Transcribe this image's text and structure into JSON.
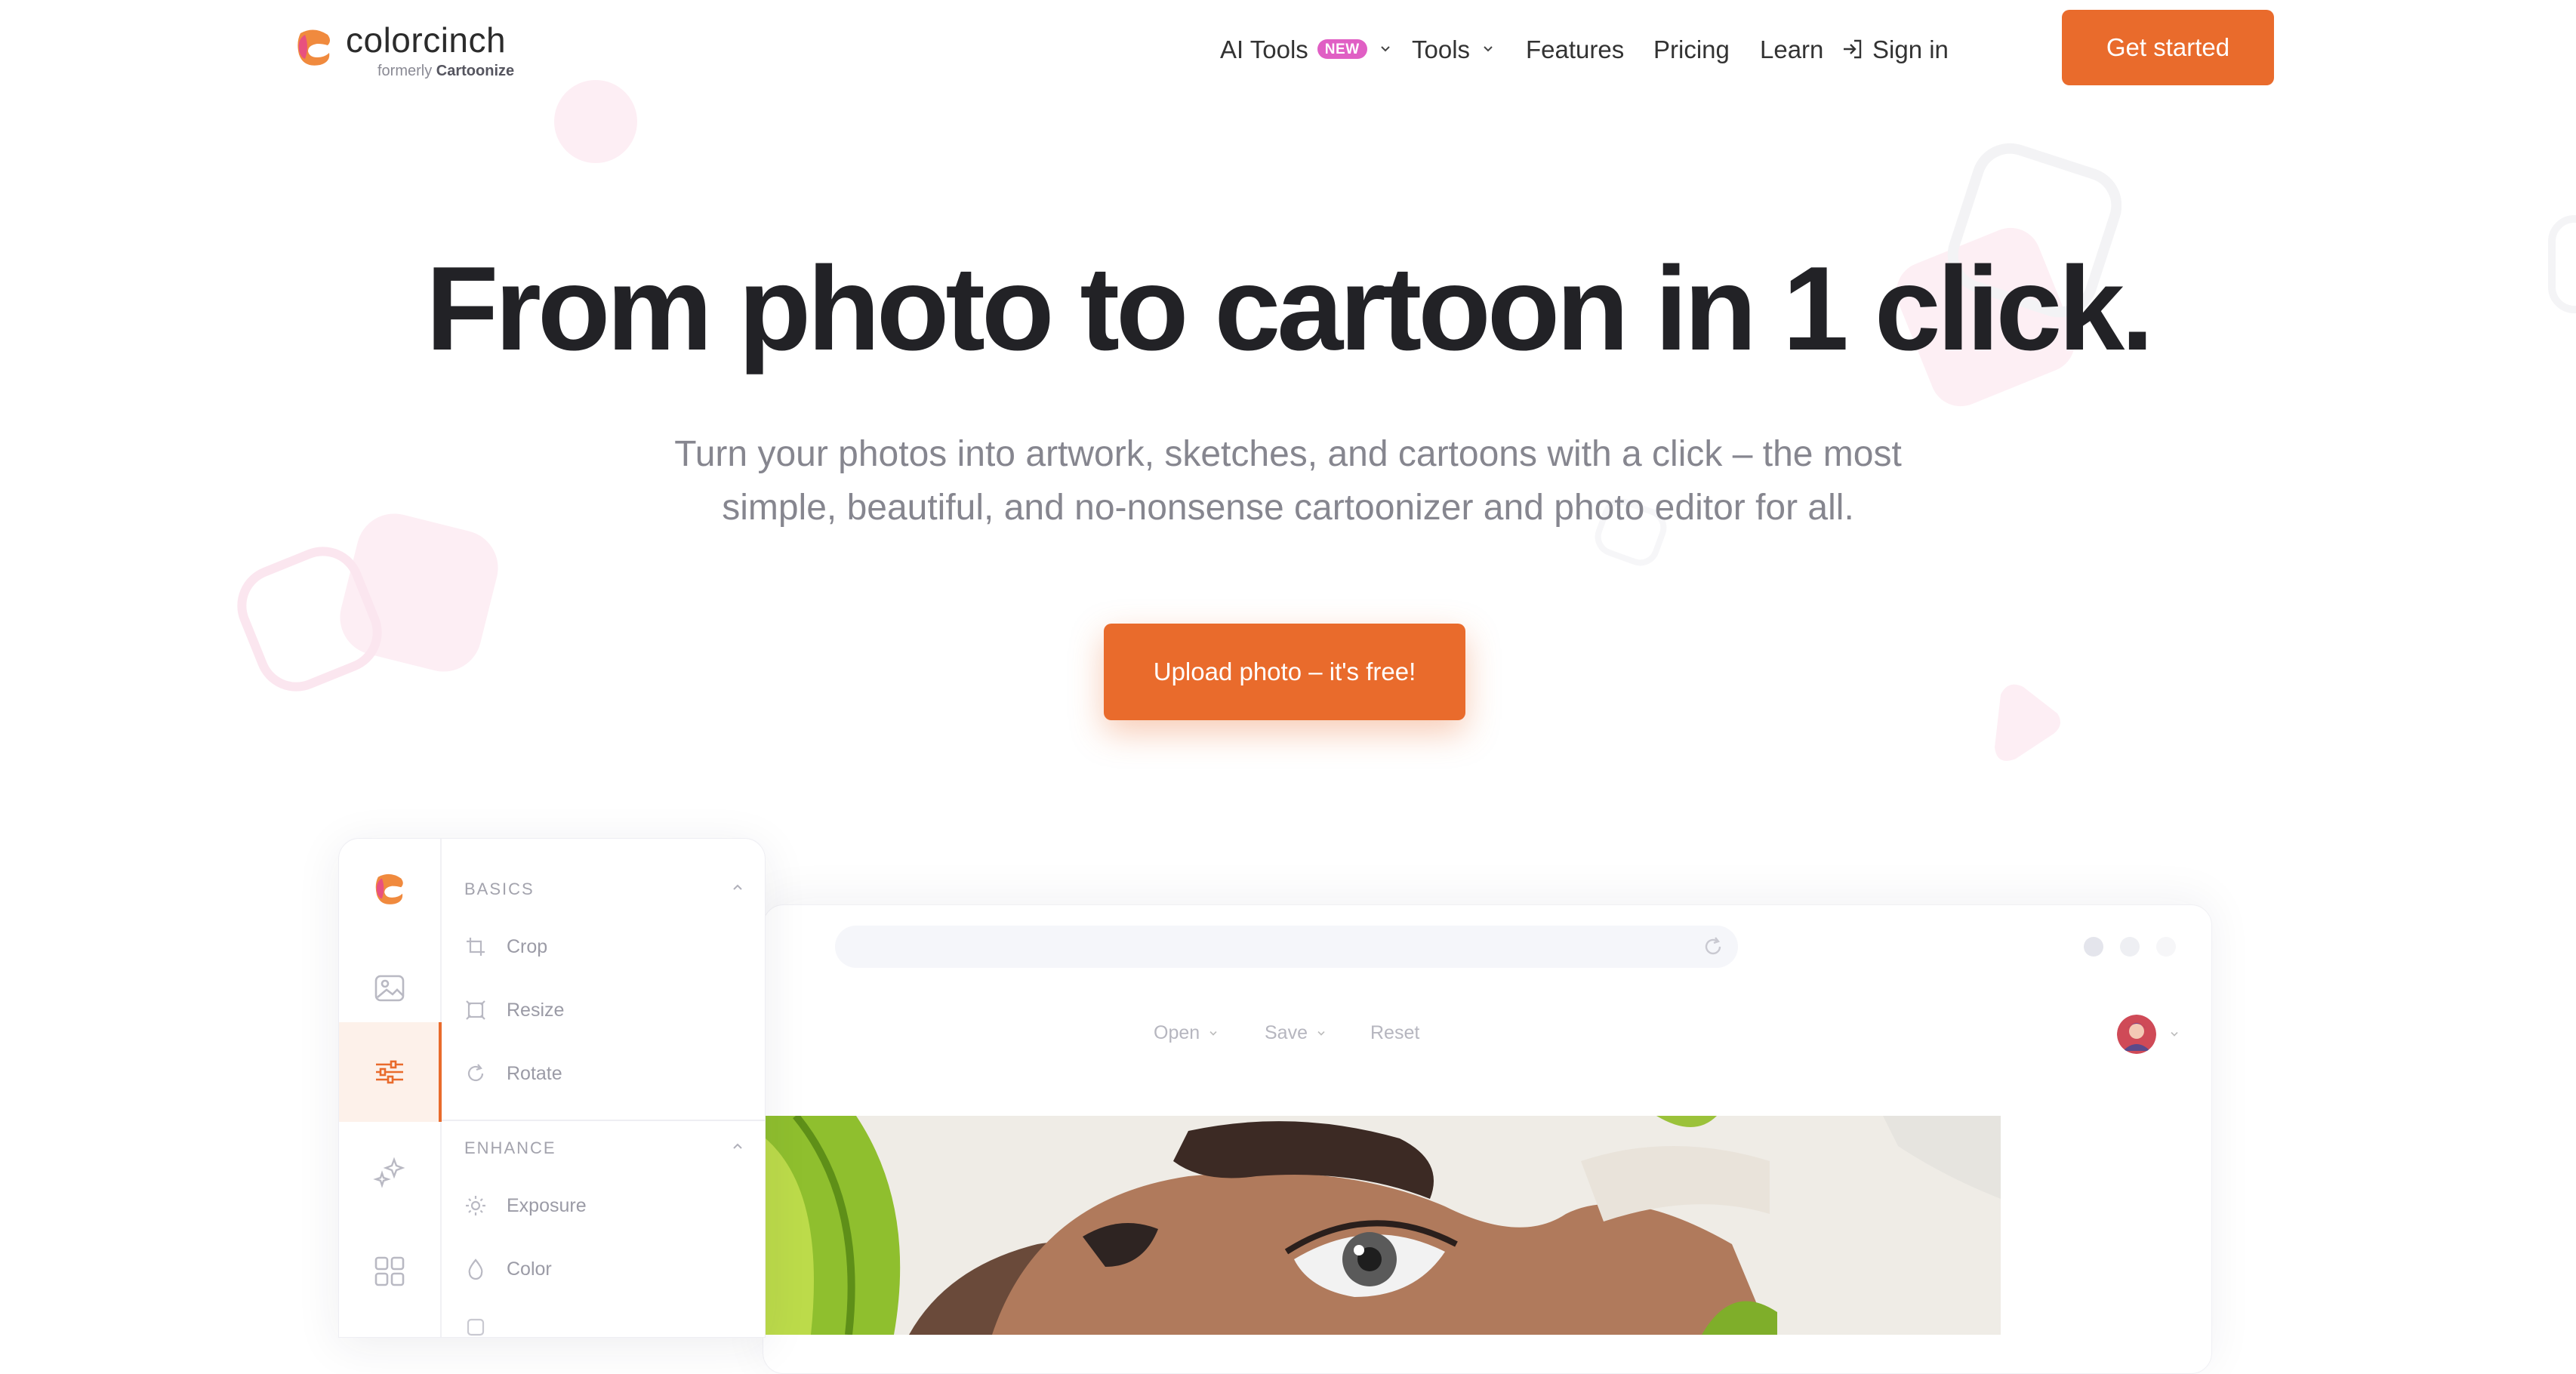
{
  "header": {
    "logo_name": "colorcinch",
    "logo_sub_prefix": "formerly",
    "logo_sub_brand": "Cartoonize",
    "nav": {
      "ai_tools": "AI Tools",
      "ai_badge": "NEW",
      "tools": "Tools",
      "features": "Features",
      "pricing": "Pricing",
      "learn": "Learn",
      "sign_in": "Sign in"
    },
    "cta": "Get started"
  },
  "hero": {
    "title": "From photo to cartoon in 1 click.",
    "subtitle_line1": "Turn your photos into artwork, sketches, and cartoons with a click – the most",
    "subtitle_line2": "simple, beautiful, and no-nonsense cartoonizer and photo editor for all.",
    "upload_button": "Upload photo – it's free!"
  },
  "editor": {
    "toolbar": {
      "open": "Open",
      "save": "Save",
      "reset": "Reset"
    },
    "sections": [
      {
        "title": "BASICS",
        "items": [
          "Crop",
          "Resize",
          "Rotate"
        ]
      },
      {
        "title": "ENHANCE",
        "items": [
          "Exposure",
          "Color"
        ]
      }
    ]
  },
  "colors": {
    "accent": "#e96b2c",
    "badge": "#e05fc4",
    "title": "#222226",
    "subtitle": "#86868f"
  }
}
